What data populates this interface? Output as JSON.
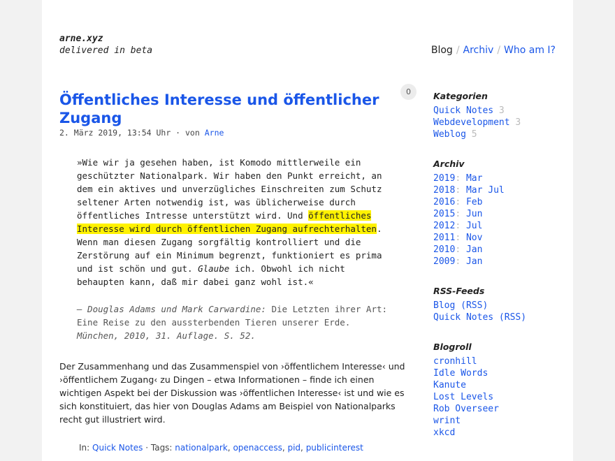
{
  "site": {
    "title": "arne.xyz",
    "tagline": "delivered in beta"
  },
  "nav": {
    "blog": "Blog",
    "sep": "/",
    "archiv": "Archiv",
    "who": "Who am I?"
  },
  "post": {
    "title": "Öffentliches Interesse und öffentlicher Zugang",
    "comments": "0",
    "date": "2. März 2019, 13:54 Uhr · von ",
    "author": "Arne",
    "quote_pre": "»Wie wir ja gesehen haben, ist Komodo mittlerweile ein geschützter Nationalpark. Wir haben den Punkt erreicht, an dem ein aktives und unverzügliches Einschreiten zum Schutz seltener Arten notwendig ist, was üblicherweise durch öffentliches Intresse unterstützt wird. Und ",
    "quote_highlight": "öffentliches Interesse wird durch öffentlichen Zugang aufrechterhalten",
    "quote_mid": ". Wenn man diesen Zugang sorgfältig kontrolliert und die Zerstörung auf ein Minimum begrenzt, funktioniert es prima und ist schön und gut. ",
    "quote_em": "Glaube",
    "quote_post": " ich. Obwohl ich nicht behaupten kann, daß mir dabei ganz wohl ist.«",
    "source_author": "— Douglas Adams und Mark Carwardine:",
    "source_book": " Die Letzten ihrer Art: Eine Reise zu den aussterbenden Tieren unserer Erde.",
    "source_pub": " München, 2010, 31. Auflage. S. 52.",
    "body": "Der Zusammenhang und das Zusammenspiel von ›öffentlichem Interesse‹ und ›öffentlichem Zugang‹ zu Dingen – etwa Informationen – finde ich einen wichtigen Aspekt bei der Diskussion was ›öffentlichen Interesse‹ ist und wie es sich konstituiert, das hier von Douglas Adams am Beispiel von Nationalparks recht gut illustriert wird.",
    "footer_in": "In: ",
    "footer_category": "Quick Notes",
    "footer_tags_label": " · Tags: ",
    "tags": [
      "nationalpark",
      "openaccess",
      "pid",
      "publicinterest"
    ]
  },
  "sidebar": {
    "categories_title": "Kategorien",
    "categories": [
      {
        "name": "Quick Notes",
        "count": "3"
      },
      {
        "name": "Webdevelopment",
        "count": "3"
      },
      {
        "name": "Weblog",
        "count": "5"
      }
    ],
    "archive_title": "Archiv",
    "archive": [
      {
        "year": "2019",
        "months": [
          "Mar"
        ]
      },
      {
        "year": "2018",
        "months": [
          "Mar",
          "Jul"
        ]
      },
      {
        "year": "2016",
        "months": [
          "Feb"
        ]
      },
      {
        "year": "2015",
        "months": [
          "Jun"
        ]
      },
      {
        "year": "2012",
        "months": [
          "Jul"
        ]
      },
      {
        "year": "2011",
        "months": [
          "Nov"
        ]
      },
      {
        "year": "2010",
        "months": [
          "Jan"
        ]
      },
      {
        "year": "2009",
        "months": [
          "Jan"
        ]
      }
    ],
    "rss_title": "RSS-Feeds",
    "rss": [
      "Blog (RSS)",
      "Quick Notes (RSS)"
    ],
    "blogroll_title": "Blogroll",
    "blogroll": [
      "cronhill",
      "Idle Words",
      "Kanute",
      "Lost Levels",
      "Rob Overseer",
      "wrint",
      "xkcd"
    ]
  },
  "colors": {
    "link": "#1a56e8",
    "highlight": "#fff200",
    "muted": "#bbbbbb"
  }
}
